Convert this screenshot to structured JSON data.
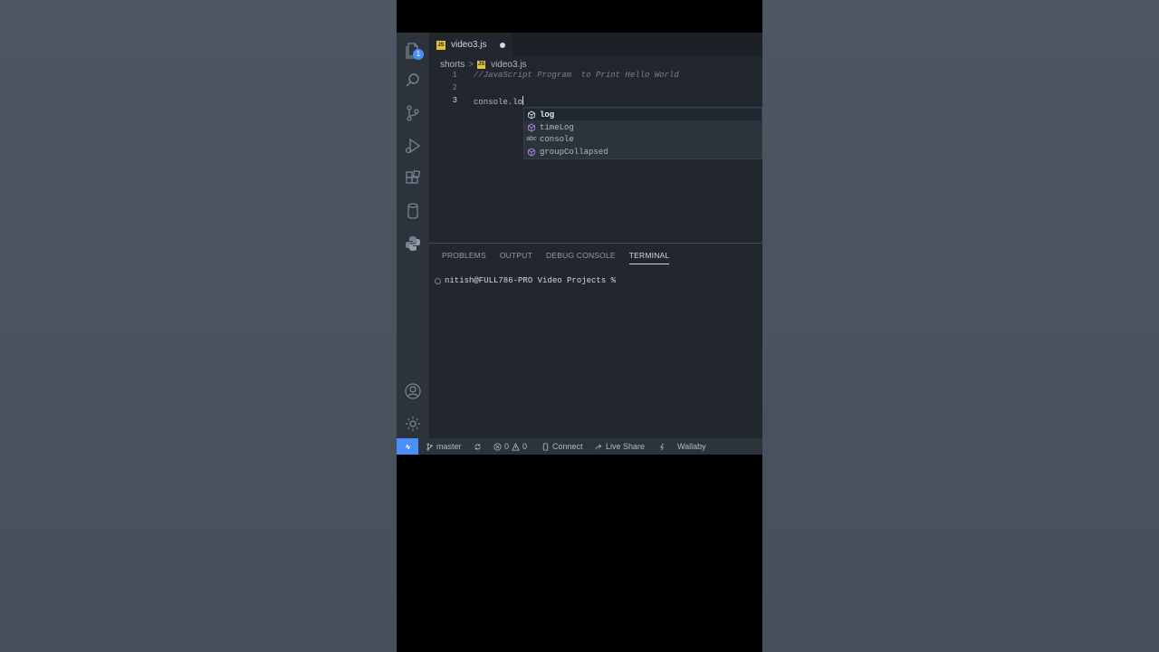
{
  "tab": {
    "filename": "video3.js",
    "js_label": "JS"
  },
  "breadcrumb": {
    "folder": "shorts",
    "separator": ">",
    "file": "video3.js"
  },
  "code": {
    "lines": [
      {
        "number": "1",
        "text": "//JavaScript Program  to Print Hello World"
      },
      {
        "number": "2",
        "text": ""
      },
      {
        "number": "3",
        "prefix": "console.",
        "typed": "lo"
      }
    ]
  },
  "suggestions": {
    "items": [
      {
        "label": "log",
        "kind": "method"
      },
      {
        "label": "timeLog",
        "kind": "method"
      },
      {
        "label": "console",
        "kind": "text",
        "kind_label": "abc"
      },
      {
        "label": "groupCollapsed",
        "kind": "method"
      }
    ]
  },
  "panel": {
    "tabs": [
      "PROBLEMS",
      "OUTPUT",
      "DEBUG CONSOLE",
      "TERMINAL"
    ],
    "active_tab": "TERMINAL",
    "terminal_prompt": "nitish@FULL786-PRO Video Projects %"
  },
  "activity_bar": {
    "explorer_badge": "1"
  },
  "statusbar": {
    "branch": "master",
    "errors": "0",
    "warnings": "0",
    "connect": "Connect",
    "live_share": "Live Share",
    "wallaby": "Wallaby"
  },
  "colors": {
    "accent": "#4c8ef7",
    "editor_bg": "#22272e",
    "js_badge": "#e5c33d",
    "method_icon": "#b083f0"
  }
}
